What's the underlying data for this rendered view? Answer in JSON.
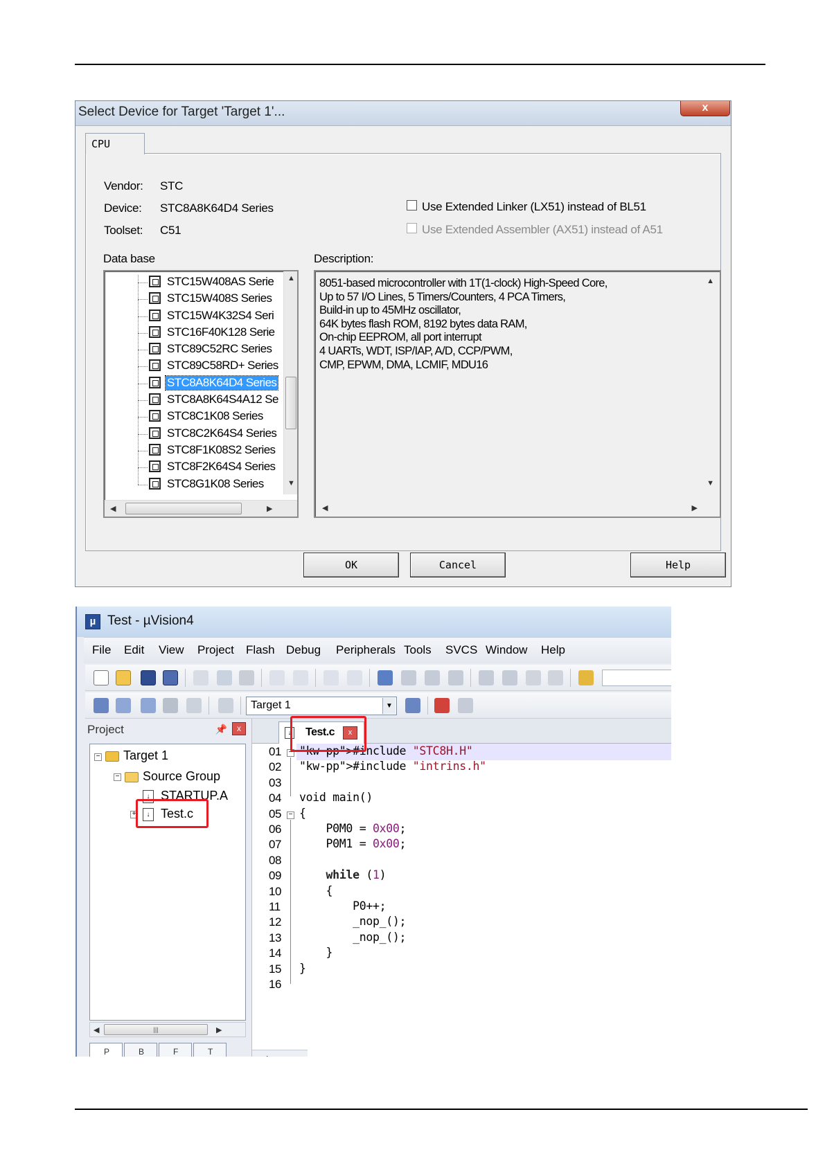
{
  "dialog": {
    "title": "Select Device for Target 'Target 1'...",
    "close_glyph": "x",
    "tab_cpu": "CPU",
    "vendor_label": "Vendor:",
    "vendor_value": "STC",
    "device_label": "Device:",
    "device_value": "STC8A8K64D4 Series",
    "toolset_label": "Toolset:",
    "toolset_value": "C51",
    "use_lx51_label": "Use Extended Linker (LX51) instead of BL51",
    "use_lx51_checked": false,
    "use_ax51_label": "Use Extended Assembler (AX51) instead of A51",
    "use_ax51_checked": false,
    "database_label": "Data base",
    "description_label": "Description:",
    "database_items": [
      "STC15W408AS Serie",
      "STC15W408S Series",
      "STC15W4K32S4 Seri",
      "STC16F40K128 Serie",
      "STC89C52RC Series",
      "STC89C58RD+ Series",
      "STC8A8K64D4 Series",
      "STC8A8K64S4A12 Se",
      "STC8C1K08 Series",
      "STC8C2K64S4 Series",
      "STC8F1K08S2 Series",
      "STC8F2K64S4 Series",
      "STC8G1K08 Series"
    ],
    "selected_index": 6,
    "description": "8051-based microcontroller with 1T(1-clock) High-Speed Core,\nUp to 57 I/O Lines, 5 Timers/Counters, 4 PCA Timers,\nBuild-in up to 45MHz oscillator,\n64K bytes flash ROM, 8192 bytes data RAM,\nOn-chip EEPROM, all port interrupt\n4 UARTs, WDT, ISP/IAP, A/D, CCP/PWM,\nCMP, EPWM, DMA, LCMIF, MDU16",
    "ok_label": "OK",
    "cancel_label": "Cancel",
    "help_label": "Help"
  },
  "uvision": {
    "title": "Test  - µVision4",
    "menu": [
      "File",
      "Edit",
      "View",
      "Project",
      "Flash",
      "Debug",
      "Peripherals",
      "Tools",
      "SVCS",
      "Window",
      "Help"
    ],
    "target_select": "Target 1",
    "project_panel_title": "Project",
    "tree": {
      "target": "Target 1",
      "group": "Source Group",
      "files": [
        "STARTUP.A",
        "Test.c"
      ]
    },
    "editor_tab": "Test.c",
    "line_numbers": [
      "01",
      "02",
      "03",
      "04",
      "05",
      "06",
      "07",
      "08",
      "09",
      "10",
      "11",
      "12",
      "13",
      "14",
      "15",
      "16"
    ],
    "code_lines": [
      "#include \"STC8H.H\"",
      "#include \"intrins.h\"",
      "",
      "void main()",
      "{",
      "    P0M0 = 0x00;",
      "    P0M1 = 0x00;",
      "",
      "    while (1)",
      "    {",
      "        P0++;",
      "        _nop_();",
      "        _nop_();",
      "    }",
      "}",
      ""
    ],
    "highlight_color": "#e51c23"
  }
}
